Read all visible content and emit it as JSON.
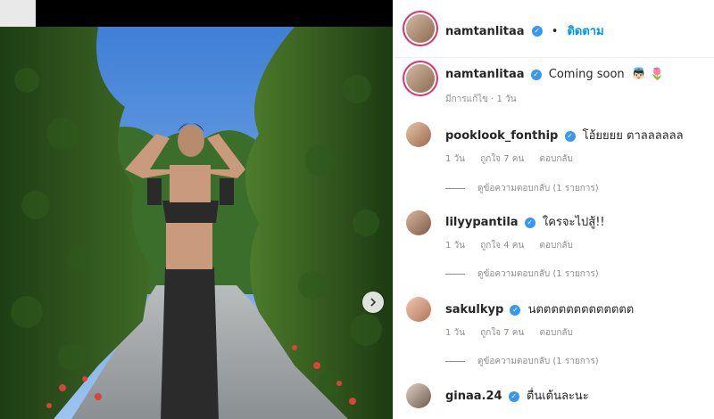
{
  "post": {
    "username": "namtanlitaa",
    "follow_label": "ติดตาม",
    "dot": "•",
    "caption_text": "Coming soon",
    "caption_emoji": "👼🏻 🌷",
    "caption_meta": "มีการแก้ไข · 1 วัน"
  },
  "comments": [
    {
      "username": "pooklook_fonthip",
      "text": "โอ้ยยยย ตาลลลลลล",
      "time": "1 วัน",
      "likes": "ถูกใจ 7 คน",
      "reply": "ตอบกลับ",
      "view_replies": "ดูข้อความตอบกลับ (1 รายการ)"
    },
    {
      "username": "lilyypantila",
      "text": "ใครจะไปสู้!!",
      "time": "1 วัน",
      "likes": "ถูกใจ 4 คน",
      "reply": "ตอบกลับ",
      "view_replies": "ดูข้อความตอบกลับ (1 รายการ)"
    },
    {
      "username": "sakulkyp",
      "text": "นตตตตตตตตตตตตต",
      "time": "1 วัน",
      "likes": "ถูกใจ 7 คน",
      "reply": "ตอบกลับ",
      "view_replies": "ดูข้อความตอบกลับ (1 รายการ)"
    },
    {
      "username": "ginaa.24",
      "text": "ตื่นเต้นละนะ"
    }
  ],
  "icons": {
    "verified": "verified-badge-icon",
    "next": "chevron-right-icon"
  },
  "colors": {
    "link": "#0095f6",
    "verified": "#3897f0",
    "muted": "#8e8e8e"
  }
}
